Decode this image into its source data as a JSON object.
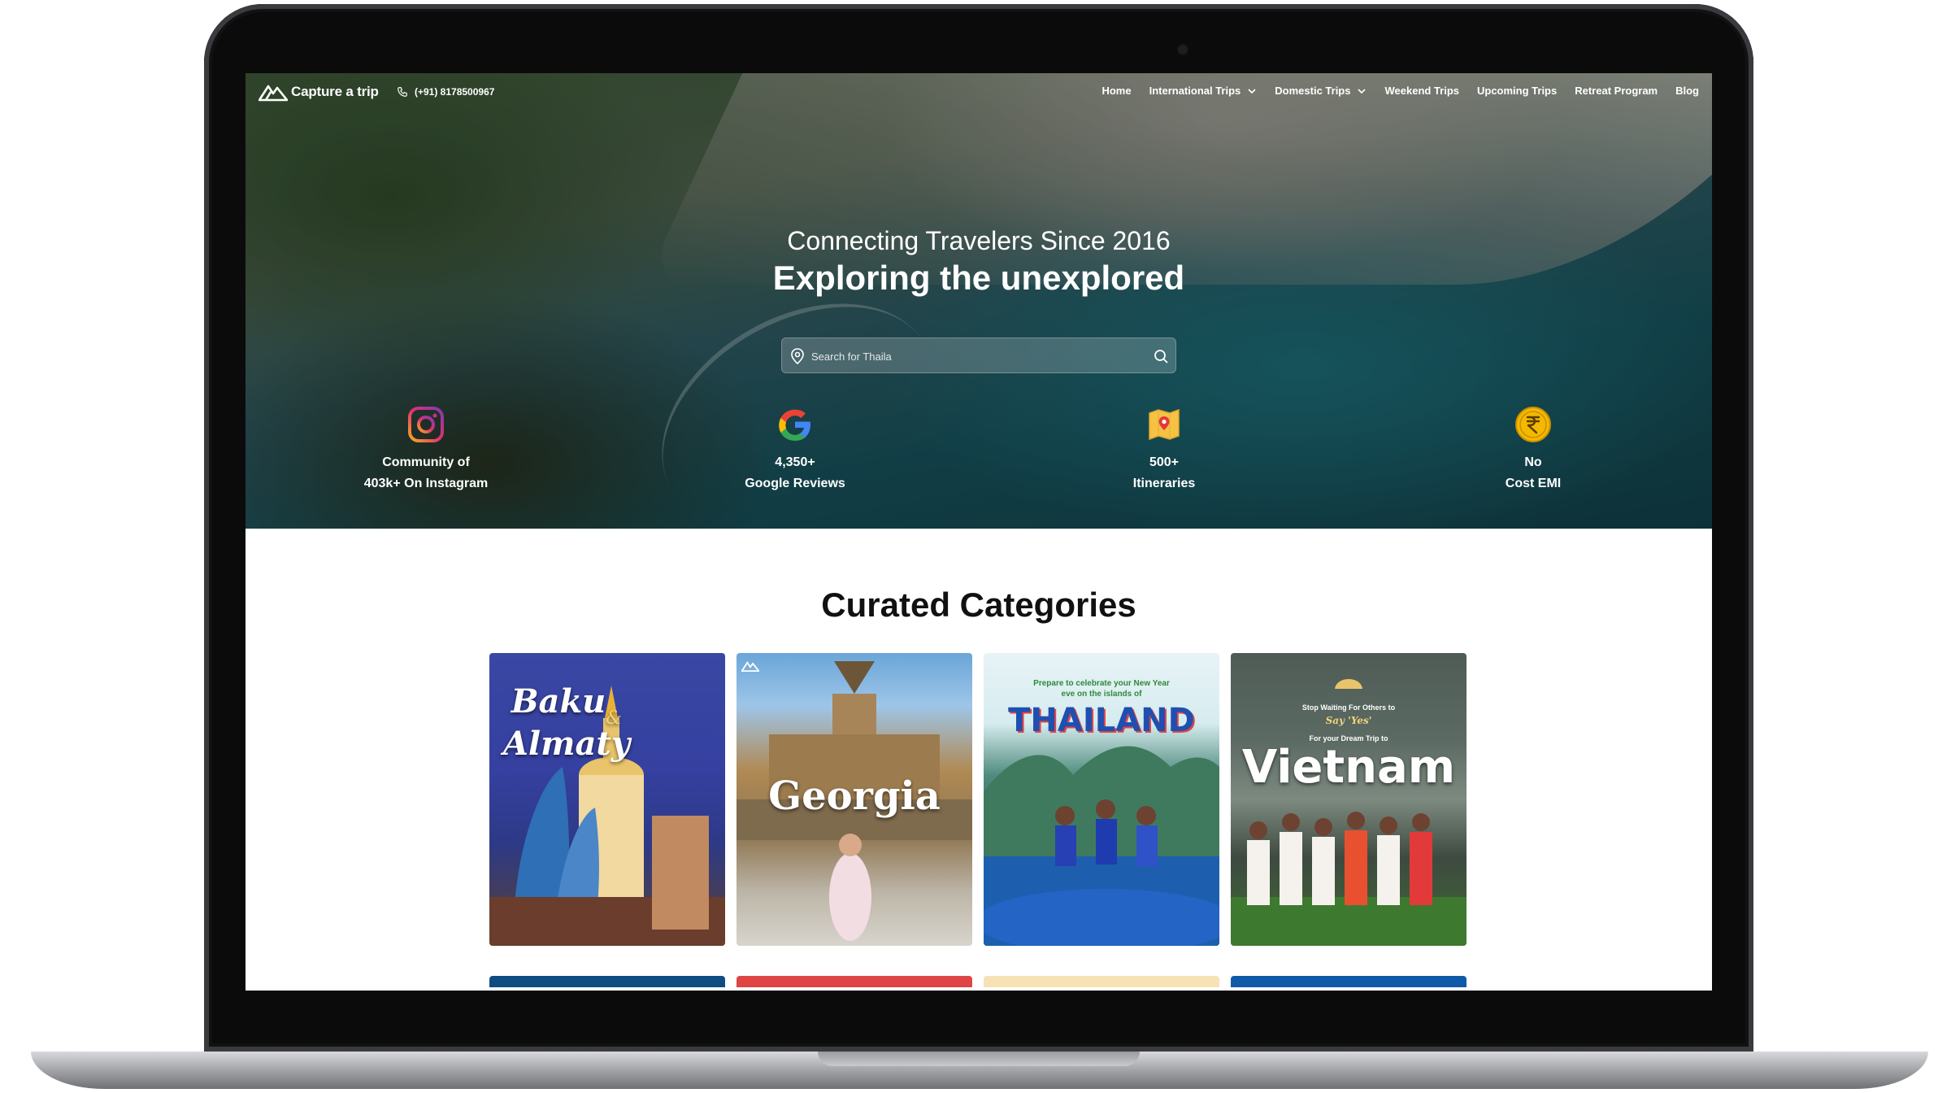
{
  "site": {
    "logo_text": "Capture a trip",
    "phone": "(+91) 8178500967"
  },
  "nav": {
    "items": [
      {
        "label": "Home"
      },
      {
        "label": "International Trips"
      },
      {
        "label": "Domestic Trips"
      },
      {
        "label": "Weekend Trips"
      },
      {
        "label": "Upcoming Trips"
      },
      {
        "label": "Retreat Program"
      },
      {
        "label": "Blog"
      }
    ]
  },
  "hero": {
    "tagline": "Connecting Travelers Since 2016",
    "headline": "Exploring the unexplored",
    "search_placeholder": "Search for Thaila"
  },
  "stats": [
    {
      "icon": "instagram-icon",
      "line1": "Community of",
      "line2": "403k+ On Instagram"
    },
    {
      "icon": "google-icon",
      "line1": "4,350+",
      "line2": "Google Reviews"
    },
    {
      "icon": "map-pin-icon",
      "line1": "500+",
      "line2": "Itineraries"
    },
    {
      "icon": "rupee-coin-icon",
      "line1": "No",
      "line2": "Cost EMI"
    }
  ],
  "categories": {
    "title": "Curated Categories",
    "cards": [
      {
        "line1": "Baku",
        "amp": "&",
        "line2": "Almaty"
      },
      {
        "title": "Georgia"
      },
      {
        "pre": "Prepare to celebrate your New Year",
        "pre2": "eve on the islands of",
        "title": "THAILAND"
      },
      {
        "pre": "Stop Waiting For Others to",
        "script": "Say 'Yes'",
        "pre2": "For your Dream Trip to",
        "title": "Vietnam"
      }
    ]
  },
  "colors": {
    "accent_strips": [
      "#0f4c81",
      "#e04545",
      "#f7e2b5",
      "#0f5aa8"
    ]
  }
}
